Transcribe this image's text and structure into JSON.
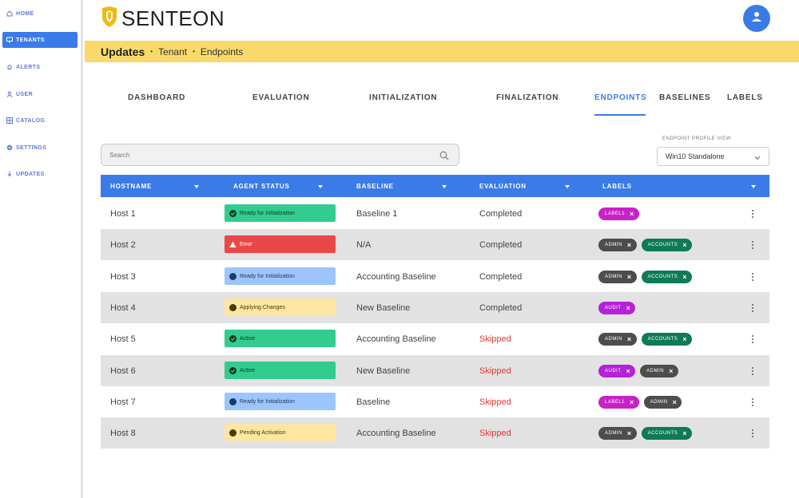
{
  "sidebar": {
    "items": [
      {
        "label": "HOME",
        "icon": "home-icon"
      },
      {
        "label": "TENANTS",
        "icon": "monitor-icon"
      },
      {
        "label": "ALERTS",
        "icon": "bell-icon"
      },
      {
        "label": "USER",
        "icon": "user-icon"
      },
      {
        "label": "CATALOG",
        "icon": "catalog-icon"
      },
      {
        "label": "SETTINGS",
        "icon": "gear-icon"
      },
      {
        "label": "UPDATES",
        "icon": "updates-icon"
      }
    ],
    "active_index": 1
  },
  "header": {
    "brand": "SENTEON",
    "avatar_icon": "user-icon"
  },
  "breadcrumb": {
    "title": "Updates",
    "items": [
      "Tenant",
      "Endpoints"
    ]
  },
  "tabs": [
    {
      "label": "DASHBOARD"
    },
    {
      "label": "EVALUATION"
    },
    {
      "label": "INITIALIZATION"
    },
    {
      "label": "FINALIZATION"
    },
    {
      "label": "ENDPOINTS"
    },
    {
      "label": "BASELINES"
    },
    {
      "label": "LABELS"
    }
  ],
  "active_tab": "ENDPOINTS",
  "search": {
    "placeholder": "Search",
    "value": ""
  },
  "profile_view": {
    "label": "ENDPOINT PROFILE VIEW",
    "value": "Win10 Standalone"
  },
  "table": {
    "columns": [
      "HOSTNAME",
      "AGENT STATUS",
      "BASELINE",
      "EVALUATION",
      "LABELS"
    ],
    "rows": [
      {
        "hostname": "Host 1",
        "status": "Ready for Initialization",
        "status_type": "green",
        "baseline": "Baseline 1",
        "evaluation": "Completed",
        "eval_type": "ok",
        "labels": [
          {
            "text": "LABEL1",
            "color": "#c821c8"
          }
        ]
      },
      {
        "hostname": "Host 2",
        "status": "Error",
        "status_type": "red",
        "baseline": "N/A",
        "evaluation": "Completed",
        "eval_type": "ok",
        "labels": [
          {
            "text": "ADMIN",
            "color": "#4d4d4d"
          },
          {
            "text": "ACCOUNTS",
            "color": "#0e7a56"
          }
        ]
      },
      {
        "hostname": "Host 3",
        "status": "Ready for Initialization",
        "status_type": "blue",
        "baseline": "Accounting Baseline",
        "evaluation": "Completed",
        "eval_type": "ok",
        "labels": [
          {
            "text": "ADMIN",
            "color": "#4d4d4d"
          },
          {
            "text": "ACCOUNTS",
            "color": "#0e7a56"
          }
        ]
      },
      {
        "hostname": "Host 4",
        "status": "Applying Changes",
        "status_type": "yellow",
        "baseline": "New Baseline",
        "evaluation": "Completed",
        "eval_type": "ok",
        "labels": [
          {
            "text": "AUDIT",
            "color": "#b521d8"
          }
        ]
      },
      {
        "hostname": "Host 5",
        "status": "Active",
        "status_type": "green",
        "baseline": "Accounting Baseline",
        "evaluation": "Skipped",
        "eval_type": "skip",
        "labels": [
          {
            "text": "ADMIN",
            "color": "#4d4d4d"
          },
          {
            "text": "ACCOUNTS",
            "color": "#0e7a56"
          }
        ]
      },
      {
        "hostname": "Host 6",
        "status": "Active",
        "status_type": "green",
        "baseline": "New Baseline",
        "evaluation": "Skipped",
        "eval_type": "skip",
        "labels": [
          {
            "text": "AUDIT",
            "color": "#b521d8"
          },
          {
            "text": "ADMIN",
            "color": "#4d4d4d"
          }
        ]
      },
      {
        "hostname": "Host 7",
        "status": "Ready for Initialization",
        "status_type": "blue",
        "baseline": "Baseline",
        "evaluation": "Skipped",
        "eval_type": "skip",
        "labels": [
          {
            "text": "LABEL1",
            "color": "#c821c8"
          },
          {
            "text": "ADMIN",
            "color": "#4d4d4d"
          }
        ]
      },
      {
        "hostname": "Host 8",
        "status": "Pending Activation",
        "status_type": "yellow",
        "baseline": "Accounting Baseline",
        "evaluation": "Skipped",
        "eval_type": "skip",
        "labels": [
          {
            "text": "ADMIN",
            "color": "#4d4d4d"
          },
          {
            "text": "ACCOUNTS",
            "color": "#0e7a56"
          }
        ]
      }
    ]
  },
  "colors": {
    "accent": "#3b7be8",
    "header_bar": "#f9d96a",
    "status_green": "#33cc8f",
    "status_red": "#ea4848",
    "status_blue": "#9cc5fb",
    "status_yellow": "#fce6a2",
    "skipped": "#e53935"
  }
}
